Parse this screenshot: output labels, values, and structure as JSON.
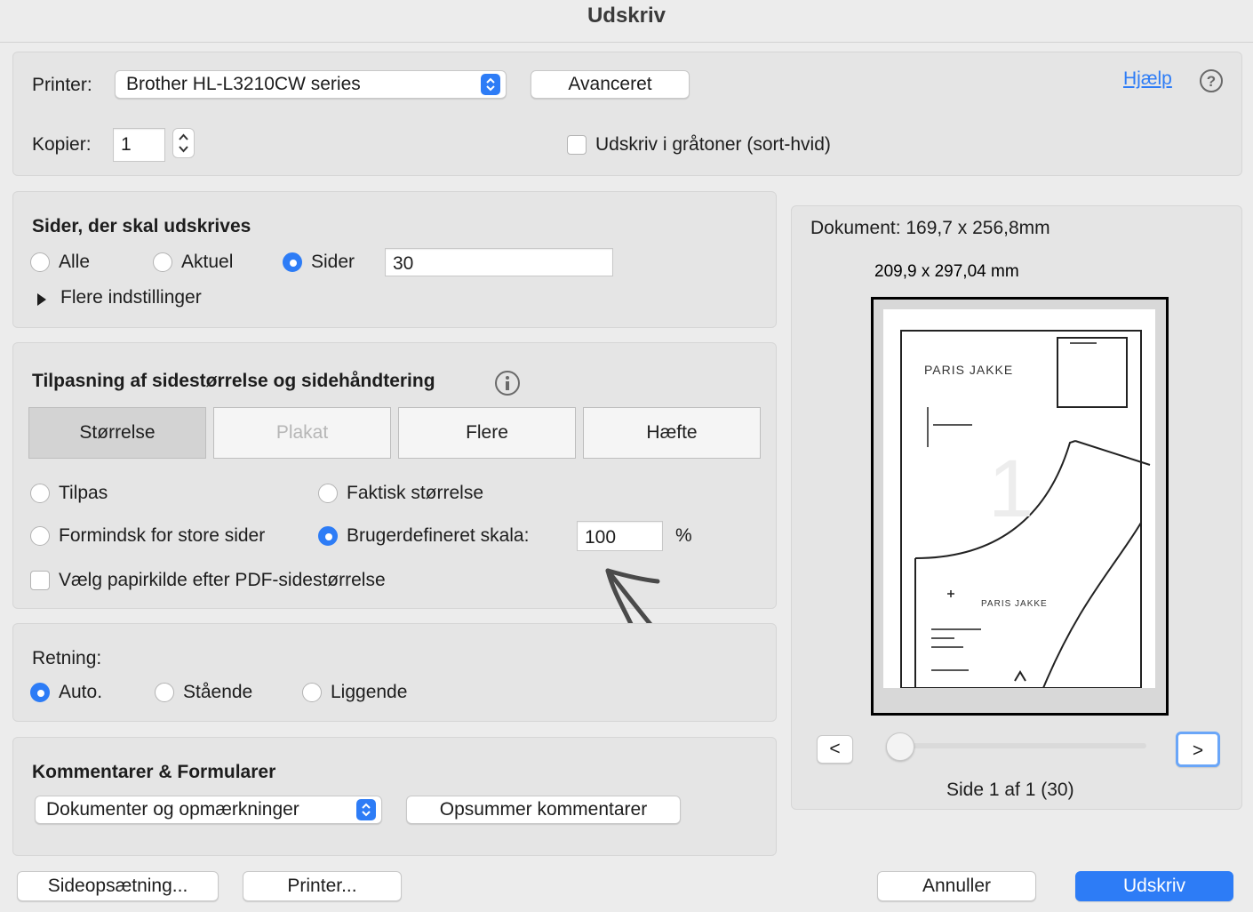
{
  "window": {
    "title": "Udskriv"
  },
  "printer_section": {
    "printer_label": "Printer:",
    "printer_value": "Brother HL-L3210CW series",
    "advanced_label": "Avanceret",
    "help_label": "Hjælp",
    "copies_label": "Kopier:",
    "copies_value": "1",
    "grayscale_label": "Udskriv i gråtoner (sort-hvid)",
    "grayscale_checked": false
  },
  "pages_section": {
    "heading": "Sider, der skal udskrives",
    "options": [
      "Alle",
      "Aktuel",
      "Sider"
    ],
    "selected": "Sider",
    "pages_value": "30",
    "more_settings_label": "Flere indstillinger"
  },
  "scaling_section": {
    "heading": "Tilpasning af sidestørrelse og sidehåndtering",
    "tabs": [
      "Størrelse",
      "Plakat",
      "Flere",
      "Hæfte"
    ],
    "active_tab": "Størrelse",
    "disabled_tab": "Plakat",
    "fit_label": "Tilpas",
    "actual_size_label": "Faktisk størrelse",
    "shrink_label": "Formindsk for store sider",
    "custom_scale_label": "Brugerdefineret skala:",
    "custom_scale_value": "100",
    "percent_label": "%",
    "paper_source_label": "Vælg papirkilde efter PDF-sidestørrelse",
    "selected": "Brugerdefineret skala:"
  },
  "orientation_section": {
    "heading": "Retning:",
    "options": [
      "Auto.",
      "Stående",
      "Liggende"
    ],
    "selected": "Auto."
  },
  "comments_section": {
    "heading": "Kommentarer & Formularer",
    "select_value": "Dokumenter og opmærkninger",
    "summarize_label": "Opsummer kommentarer"
  },
  "preview": {
    "document_label": "Dokument: 169,7 x 256,8mm",
    "paper_size_label": "209,9 x 297,04 mm",
    "page_text_brand": "PARIS JAKKE",
    "page_text_brand_small": "PARIS JAKKE",
    "page_label": "Side 1 af 1 (30)",
    "prev_label": "<",
    "next_label": ">",
    "page_number_watermark": "1"
  },
  "footer": {
    "page_setup_label": "Sideopsætning...",
    "printer_label": "Printer...",
    "cancel_label": "Annuller",
    "print_label": "Udskriv"
  }
}
